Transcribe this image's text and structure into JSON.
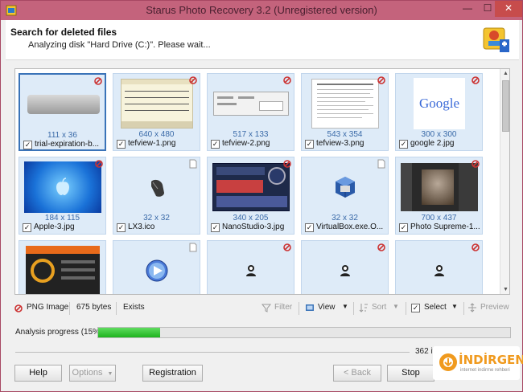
{
  "window": {
    "title": "Starus Photo Recovery 3.2 (Unregistered version)",
    "controls": {
      "minimize": "—",
      "maximize": "☐",
      "close": "✕"
    }
  },
  "header": {
    "title": "Search for deleted files",
    "subtitle": "Analyzing disk \"Hard Drive (C:)\". Please wait..."
  },
  "files": [
    {
      "name": "trial-expiration-b...",
      "dims": "111 x 36",
      "checked": true,
      "selected": true
    },
    {
      "name": "tefview-1.png",
      "dims": "640 x 480",
      "checked": true
    },
    {
      "name": "tefview-2.png",
      "dims": "517 x 133",
      "checked": true
    },
    {
      "name": "tefview-3.png",
      "dims": "543 x 354",
      "checked": true
    },
    {
      "name": "google 2.jpg",
      "dims": "300 x 300",
      "checked": true
    },
    {
      "name": "Apple-3.jpg",
      "dims": "184 x 115",
      "checked": true
    },
    {
      "name": "LX3.ico",
      "dims": "32 x 32",
      "checked": true
    },
    {
      "name": "NanoStudio-3.jpg",
      "dims": "340 x 205",
      "checked": true
    },
    {
      "name": "VirtualBox.exe.O...",
      "dims": "32 x 32",
      "checked": true
    },
    {
      "name": "Photo Supreme-1...",
      "dims": "700 x 437",
      "checked": true
    },
    {
      "name": "",
      "dims": "",
      "checked": false
    },
    {
      "name": "",
      "dims": "",
      "checked": false
    },
    {
      "name": "",
      "dims": "",
      "checked": false
    },
    {
      "name": "",
      "dims": "",
      "checked": false
    },
    {
      "name": "",
      "dims": "",
      "checked": false
    }
  ],
  "thumb_text": {
    "google": "Google"
  },
  "toolbar": {
    "file_type": "PNG Image",
    "file_size": "675 bytes",
    "exists": "Exists",
    "filter": "Filter",
    "view": "View",
    "sort": "Sort",
    "select": "Select",
    "preview": "Preview"
  },
  "progress": {
    "label": "Analysis progress (15%)",
    "value": 0.15,
    "remaining": "362 it"
  },
  "buttons": {
    "help": "Help",
    "options": "Options",
    "registration": "Registration",
    "back": "< Back",
    "stop": "Stop"
  },
  "watermark": {
    "main": "İNDİRGEN",
    "sub": "internet indirme rehberi"
  },
  "colors": {
    "titlebar": "#c4637c",
    "tile": "#deebf8",
    "progress": "#1eb31e",
    "accent": "#3a73b8"
  }
}
